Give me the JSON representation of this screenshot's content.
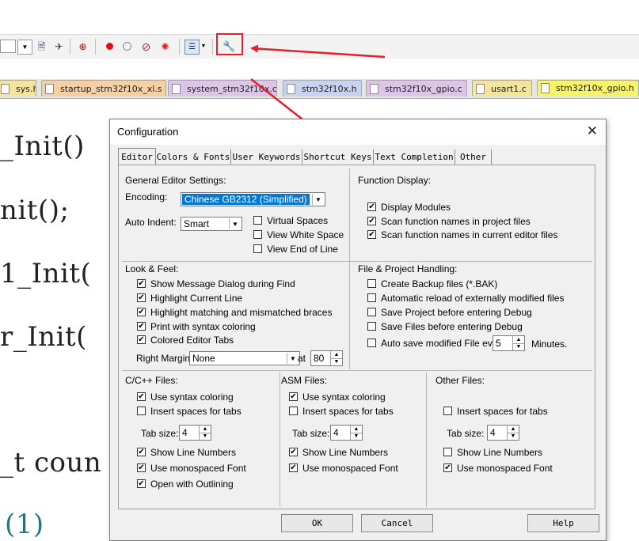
{
  "tabs": [
    {
      "label": "sys.h",
      "color": "#f3e59b"
    },
    {
      "label": "startup_stm32f10x_xl.s",
      "color": "#f6cfa2"
    },
    {
      "label": "system_stm32f10x.c",
      "color": "#ddc5e8"
    },
    {
      "label": "stm32f10x.h",
      "color": "#c7d3ef"
    },
    {
      "label": "stm32f10x_gpio.c",
      "color": "#ddc5e8"
    },
    {
      "label": "usart1.c",
      "color": "#f3e59b"
    },
    {
      "label": "stm32f10x_gpio.h",
      "color": "#f7f36a"
    }
  ],
  "code_lines": [
    "_Init()",
    "nit();",
    "1_Init(",
    "r_Init(",
    "_t coun",
    "(1)"
  ],
  "dialog": {
    "title": "Configuration",
    "close_glyph": "✕",
    "tabs": [
      "Editor",
      "Colors & Fonts",
      "User Keywords",
      "Shortcut Keys",
      "Text Completion",
      "Other"
    ],
    "active_tab": "Editor",
    "general": {
      "heading": "General Editor Settings:",
      "encoding_label": "Encoding:",
      "encoding_value": "Chinese GB2312 (Simplified)",
      "auto_indent_label": "Auto Indent:",
      "auto_indent_value": "Smart",
      "virtual_spaces": "Virtual Spaces",
      "view_white_space": "View White Space",
      "view_end_of_line": "View End of Line"
    },
    "function_display": {
      "heading": "Function Display:",
      "items": [
        "Display Modules",
        "Scan function names in project files",
        "Scan function names in current editor files"
      ]
    },
    "look_feel": {
      "heading": "Look & Feel:",
      "items": [
        "Show Message Dialog during Find",
        "Highlight Current Line",
        "Highlight matching and mismatched braces",
        "Print with syntax coloring",
        "Colored Editor Tabs"
      ],
      "right_margin_label": "Right Margin:",
      "right_margin_value": "None",
      "at_label": "at",
      "at_value": "80"
    },
    "file_project": {
      "heading": "File & Project Handling:",
      "items": [
        "Create Backup files (*.BAK)",
        "Automatic reload of externally modified files",
        "Save Project before entering Debug",
        "Save Files before entering Debug",
        "Auto save modified File every"
      ],
      "autosave_value": "5",
      "minutes_label": "Minutes."
    },
    "cpp_files": {
      "heading": "C/C++ Files:",
      "use_syntax": "Use syntax coloring",
      "insert_spaces": "Insert spaces for tabs",
      "tab_size_label": "Tab size:",
      "tab_size": "4",
      "show_line_numbers": "Show Line Numbers",
      "monospaced": "Use monospaced Font",
      "outlining": "Open with Outlining"
    },
    "asm_files": {
      "heading": "ASM Files:",
      "use_syntax": "Use syntax coloring",
      "insert_spaces": "Insert spaces for tabs",
      "tab_size_label": "Tab size:",
      "tab_size": "4",
      "show_line_numbers": "Show Line Numbers",
      "monospaced": "Use monospaced Font"
    },
    "other_files": {
      "heading": "Other Files:",
      "insert_spaces": "Insert spaces for tabs",
      "tab_size_label": "Tab size:",
      "tab_size": "4",
      "show_line_numbers": "Show Line Numbers",
      "monospaced": "Use monospaced Font"
    },
    "buttons": {
      "ok": "OK",
      "cancel": "Cancel",
      "help": "Help"
    }
  },
  "check_glyph": "✔",
  "accent_red": "#e4202a",
  "selection_blue": "#0078d7"
}
